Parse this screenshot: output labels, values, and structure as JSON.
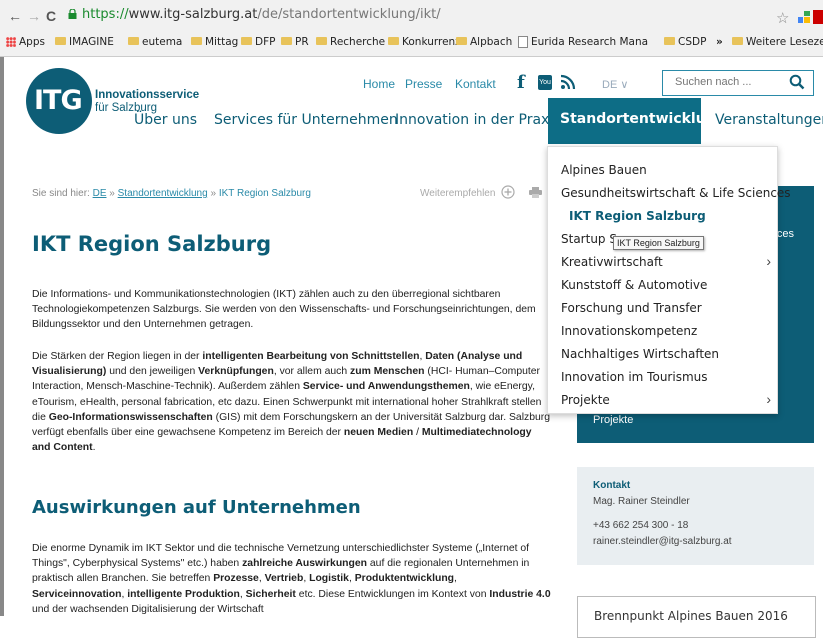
{
  "browser": {
    "url_scheme": "https://",
    "url_host": "www.itg-salzburg.at",
    "url_path": "/de/standortentwicklung/ikt/",
    "bookmarks": [
      "Apps",
      "IMAGINE",
      "eutema",
      "Mittag",
      "DFP",
      "PR",
      "Recherche",
      "Konkurrenz",
      "Alpbach",
      "Eurida Research Mana",
      "CSDP"
    ],
    "bookmarks_more": "»",
    "bookmarks_other": "Weitere Lesezeich"
  },
  "header": {
    "logo_text": "ITG",
    "brand_line1": "Innovationsservice",
    "brand_line2": "für Salzburg",
    "top_links": [
      "Home",
      "Presse",
      "Kontakt"
    ],
    "lang": "DE ∨",
    "search_placeholder": "Suchen nach ...",
    "facebook": "f",
    "youtube": "You"
  },
  "nav": {
    "items": [
      "Über uns",
      "Services für Unternehmen",
      "Innovation in der Praxis"
    ],
    "active": "Standortentwicklung",
    "last": "Veranstaltungen"
  },
  "dropdown": {
    "items": [
      {
        "label": "Alpines Bauen",
        "has_sub": false,
        "active": false
      },
      {
        "label": "Gesundheitswirtschaft & Life Sciences",
        "has_sub": false,
        "active": false
      },
      {
        "label": "IKT Region Salzburg",
        "has_sub": false,
        "active": true
      },
      {
        "label": "Startup Sa",
        "has_sub": false,
        "active": false
      },
      {
        "label": "Kreativwirtschaft",
        "has_sub": true,
        "active": false
      },
      {
        "label": "Kunststoff & Automotive",
        "has_sub": false,
        "active": false
      },
      {
        "label": "Forschung und Transfer",
        "has_sub": false,
        "active": false
      },
      {
        "label": "Innovationskompetenz",
        "has_sub": false,
        "active": false
      },
      {
        "label": "Nachhaltiges Wirtschaften",
        "has_sub": false,
        "active": false
      },
      {
        "label": "Innovation im Tourismus",
        "has_sub": false,
        "active": false
      },
      {
        "label": "Projekte",
        "has_sub": true,
        "active": false
      }
    ],
    "chevron": "›",
    "tooltip": "IKT Region Salzburg"
  },
  "breadcrumb": {
    "prefix": "Sie sind hier:",
    "items": [
      "DE",
      "Standortentwicklung",
      "IKT Region Salzburg"
    ],
    "sep": "»",
    "share_label": "Weiterempfehlen"
  },
  "content": {
    "title": "IKT Region Salzburg",
    "p1": "Die Informations- und Kommunikationstechnologien (IKT) zählen auch zu den überregional sichtbaren Technologiekompetenzen Salzburgs. Sie werden von den Wissenschafts- und Forschungseinrichtungen, dem Bildungssektor und den Unternehmen getragen.",
    "p2_parts": [
      {
        "t": "Die Stärken der Region liegen in der ",
        "b": false
      },
      {
        "t": "intelligenten Bearbeitung von Schnittstellen",
        "b": true
      },
      {
        "t": ", ",
        "b": false
      },
      {
        "t": "Daten (Analyse und Visualisierung)",
        "b": true
      },
      {
        "t": " und den jeweiligen ",
        "b": false
      },
      {
        "t": "Verknüpfungen",
        "b": true
      },
      {
        "t": ", vor allem auch ",
        "b": false
      },
      {
        "t": "zum Menschen",
        "b": true
      },
      {
        "t": " (HCI- Human–Computer Interaction, Mensch-Maschine-Technik). Außerdem zählen ",
        "b": false
      },
      {
        "t": "Service- und Anwendungsthemen",
        "b": true
      },
      {
        "t": ", wie eEnergy, eTourism, eHealth, personal fabrication, etc dazu. Einen Schwerpunkt mit international hoher Strahlkraft stellen die ",
        "b": false
      },
      {
        "t": "Geo-Informationswissenschaften",
        "b": true
      },
      {
        "t": " (GIS) mit dem Forschungskern an der Universität Salzburg dar. Salzburg verfügt ebenfalls über eine gewachsene Kompetenz im Bereich der ",
        "b": false
      },
      {
        "t": "neuen Medien",
        "b": true
      },
      {
        "t": " / ",
        "b": false
      },
      {
        "t": "Multimediatechnology and Content",
        "b": true
      },
      {
        "t": ".",
        "b": false
      }
    ],
    "subtitle": "Auswirkungen auf Unternehmen",
    "p3_parts": [
      {
        "t": "Die enorme Dynamik im IKT Sektor und die technische Vernetzung unterschiedlichster Systeme („Internet of Things\", Cyberphysical Systems\" etc.) haben ",
        "b": false
      },
      {
        "t": "zahlreiche Auswirkungen",
        "b": true
      },
      {
        "t": " auf die regionalen Unternehmen in praktisch allen Branchen. Sie betreffen ",
        "b": false
      },
      {
        "t": "Prozesse",
        "b": true
      },
      {
        "t": ", ",
        "b": false
      },
      {
        "t": "Vertrieb",
        "b": true
      },
      {
        "t": ", ",
        "b": false
      },
      {
        "t": "Logistik",
        "b": true
      },
      {
        "t": ", ",
        "b": false
      },
      {
        "t": "Produktentwicklung",
        "b": true
      },
      {
        "t": ", ",
        "b": false
      },
      {
        "t": "Serviceinnovation",
        "b": true
      },
      {
        "t": ", ",
        "b": false
      },
      {
        "t": "intelligente Produktion",
        "b": true
      },
      {
        "t": ", ",
        "b": false
      },
      {
        "t": "Sicherheit",
        "b": true
      },
      {
        "t": " etc. Diese Entwicklungen im Kontext von ",
        "b": false
      },
      {
        "t": "Industrie 4.0",
        "b": true
      },
      {
        "t": " und der wachsenden Digitalisierung der Wirtschaft",
        "b": false
      }
    ]
  },
  "sidebar": {
    "box_text_right": "ces",
    "box_text_bottom": "Projekte",
    "contact_heading": "Kontakt",
    "contact_name": "Mag. Rainer Steindler",
    "contact_phone": "+43 662 254 300 - 18",
    "contact_email": "rainer.steindler@itg-salzburg.at",
    "promo": "Brennpunkt Alpines Bauen 2016"
  },
  "colors": {
    "primary": "#0d5d76",
    "link": "#2a8aa8"
  }
}
